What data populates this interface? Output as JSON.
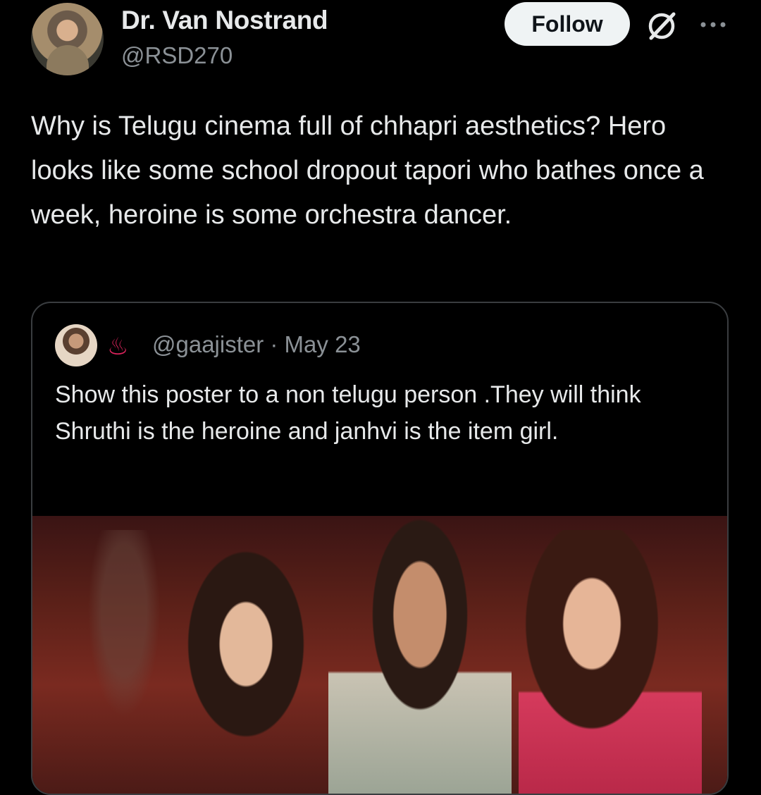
{
  "author": {
    "name": "Dr. Van Nostrand",
    "handle": "@RSD270",
    "avatar_icon": "avatar-photo"
  },
  "actions": {
    "follow_label": "Follow",
    "grok_icon": "grok-icon",
    "more_icon": "more-horizontal-icon"
  },
  "post": {
    "text": "Why is Telugu cinema full of chhapri aesthetics? Hero looks like some school dropout tapori who bathes once a week, heroine is some orchestra dancer."
  },
  "quoted": {
    "emoji": "♨",
    "handle_date": "@gaajister · May 23",
    "text": "Show this poster to a non telugu person .They will think Shruthi is the heroine and janhvi is the item girl.",
    "image_icon": "movie-poster-image"
  },
  "colors": {
    "background": "#000000",
    "text": "#e7e9ea",
    "secondary": "#8b9196",
    "follow_bg": "#eff3f4",
    "border": "#3a3d40"
  }
}
